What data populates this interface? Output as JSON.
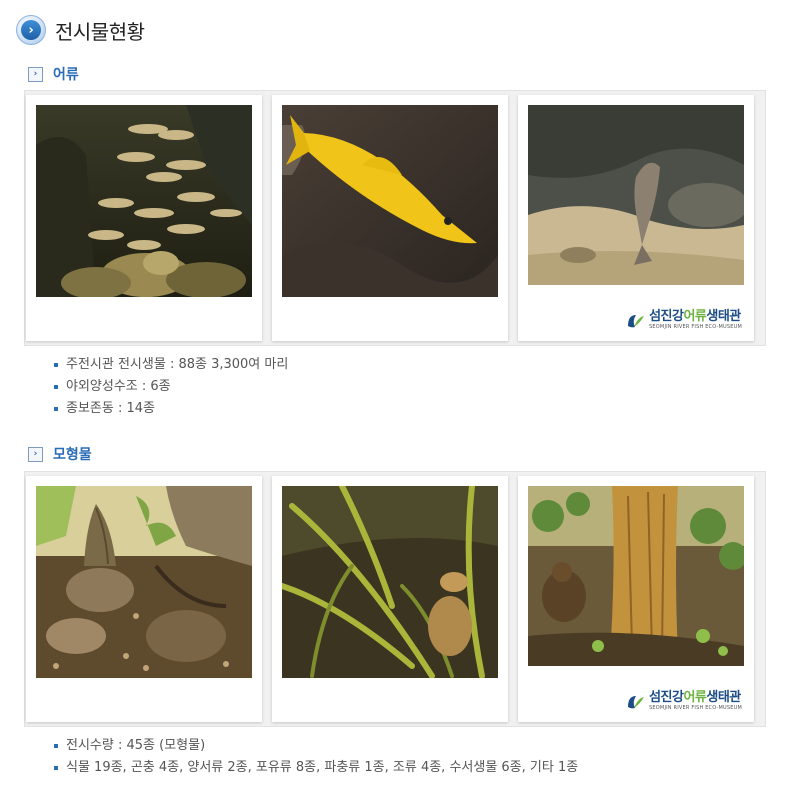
{
  "page": {
    "title": "전시물현황"
  },
  "sections": [
    {
      "label": "어류",
      "photos": [
        "schooling-fish-photo",
        "yellow-fish-photo",
        "bottom-fish-photo"
      ],
      "logo": {
        "name_part1": "섬진강",
        "name_highlight": "어류",
        "name_part2": "생태관",
        "subtitle": "SEOMJIN RIVER FISH ECO-MUSEUM"
      },
      "bullets": [
        "주전시관 전시생물 : 88종 3,300여 마리",
        "야외양성수조 : 6종",
        "종보존동 : 14종"
      ]
    },
    {
      "label": "모형물",
      "photos": [
        "snail-crayfish-model-photo",
        "grass-frog-model-photo",
        "raccoon-dog-tree-model-photo"
      ],
      "logo": {
        "name_part1": "섬진강",
        "name_highlight": "어류",
        "name_part2": "생태관",
        "subtitle": "SEOMJIN RIVER FISH ECO-MUSEUM"
      },
      "bullets": [
        "전시수량 : 45종 (모형물)",
        "식물 19종, 곤충 4종, 양서류 2종, 포유류 8종, 파충류 1종, 조류 4종, 수서생물 6종, 기타 1종"
      ]
    }
  ],
  "colors": {
    "accent": "#2b6cb6",
    "title_text": "#222222",
    "body_text": "#555555",
    "logo_green": "#6db33f",
    "logo_navy": "#1d4d86"
  }
}
